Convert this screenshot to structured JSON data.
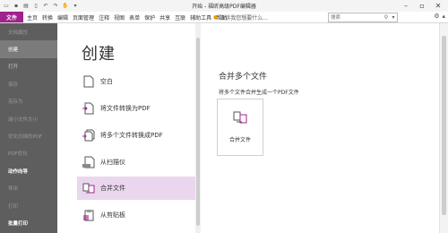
{
  "window": {
    "title": "开始 - 福昕高级PDF编辑器"
  },
  "quick_access": [
    "open-folder-icon",
    "save-icon",
    "print-icon",
    "blank-page-icon",
    "undo-icon",
    "redo-icon",
    "hand-icon",
    "dropdown-icon"
  ],
  "menu": {
    "file_tab": "文件",
    "items": [
      "主页",
      "转换",
      "编辑",
      "页面管理",
      "注释",
      "视图",
      "表单",
      "保护",
      "共享",
      "互联",
      "辅助工具",
      "帮助"
    ],
    "tell_me": "告诉我您想要什么...",
    "search_placeholder": "搜索"
  },
  "sidebar": {
    "items": [
      {
        "label": "文档属性",
        "state": "dim"
      },
      {
        "label": "创建",
        "state": "active"
      },
      {
        "label": "打开",
        "state": "normal"
      },
      {
        "label": "保存",
        "state": "dim"
      },
      {
        "label": "另存为",
        "state": "dim"
      },
      {
        "label": "减小文件大小",
        "state": "dim"
      },
      {
        "label": "优化扫描的PDF",
        "state": "dim"
      },
      {
        "label": "PDF优化",
        "state": "dim"
      },
      {
        "label": "动作向导",
        "state": "bold"
      },
      {
        "label": "导出",
        "state": "dim"
      },
      {
        "label": "打印",
        "state": "dim"
      },
      {
        "label": "批量打印",
        "state": "bold"
      }
    ]
  },
  "create_panel": {
    "title": "创建",
    "options": [
      {
        "label": "空白",
        "icon": "blank-doc-icon",
        "selected": false
      },
      {
        "label": "将文件转换为PDF",
        "icon": "file-to-pdf-icon",
        "selected": false
      },
      {
        "label": "将多个文件转换成PDF",
        "icon": "multi-file-to-pdf-icon",
        "selected": false
      },
      {
        "label": "从扫描仪",
        "icon": "scanner-icon",
        "selected": false
      },
      {
        "label": "合并文件",
        "icon": "merge-files-icon",
        "selected": true
      },
      {
        "label": "从剪贴板",
        "icon": "clipboard-icon",
        "selected": false
      }
    ]
  },
  "detail": {
    "title": "合并多个文件",
    "description": "将多个文件合并生成一个PDF文件",
    "card_label": "合并文件"
  },
  "colors": {
    "accent": "#a0228c",
    "sidebar_bg": "#5e5e5e",
    "selected_bg": "#ead7ee"
  }
}
